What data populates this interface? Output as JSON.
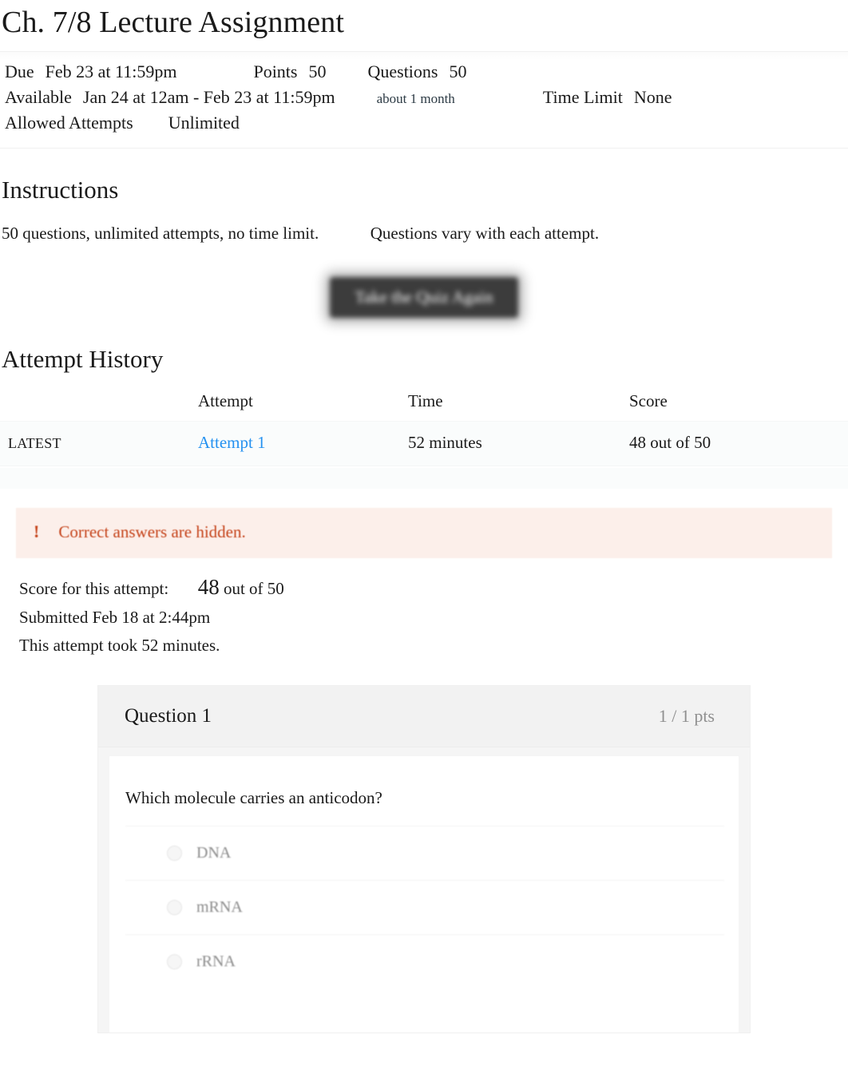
{
  "page_title": "Ch. 7/8 Lecture Assignment",
  "info": {
    "due_label": "Due",
    "due_value": "Feb 23 at 11:59pm",
    "points_label": "Points",
    "points_value": "50",
    "questions_label": "Questions",
    "questions_value": "50",
    "available_label": "Available",
    "available_value": "Jan 24 at 12am - Feb 23 at 11:59pm",
    "available_duration": "about 1 month",
    "time_limit_label": "Time Limit",
    "time_limit_value": "None",
    "attempts_label": "Allowed Attempts",
    "attempts_value": "Unlimited"
  },
  "instructions": {
    "heading": "Instructions",
    "line_part1": "50 questions, unlimited attempts, no time limit.",
    "line_part2": "Questions vary with each attempt."
  },
  "take_quiz_button": "Take the Quiz Again",
  "attempt_history": {
    "heading": "Attempt History",
    "columns": [
      "",
      "Attempt",
      "Time",
      "Score"
    ],
    "rows": [
      {
        "kept": "LATEST",
        "attempt": "Attempt 1",
        "time": "52 minutes",
        "score": "48 out of 50"
      }
    ]
  },
  "warning": {
    "icon": "!",
    "text": "Correct answers are hidden."
  },
  "attempt_summary": {
    "score_label": "Score for this attempt:",
    "score_value": "48",
    "score_suffix": "out of 50",
    "submitted": "Submitted Feb 18 at 2:44pm",
    "duration": "This attempt took 52 minutes."
  },
  "question": {
    "name": "Question 1",
    "points": "1 / 1 pts",
    "text": "Which molecule carries an anticodon?",
    "answers": [
      "DNA",
      "mRNA",
      "rRNA"
    ]
  },
  "colors": {
    "link": "#2491f0",
    "warning_text": "#c5431a",
    "warning_bg": "#fcefea",
    "button_bg": "#3c3c3c",
    "question_header_bg": "#f2f2f2"
  }
}
